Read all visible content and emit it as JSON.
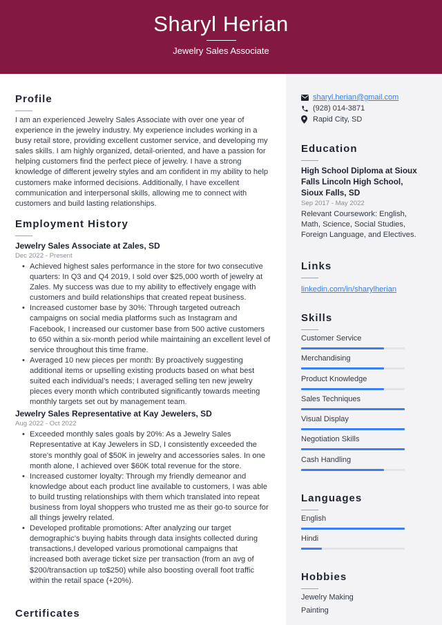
{
  "header": {
    "name": "Sharyl Herian",
    "job_title": "Jewelry Sales Associate",
    "background_color": "#831941"
  },
  "profile": {
    "title": "Profile",
    "text": "I am an experienced Jewelry Sales Associate with over one year of experience in the jewelry industry. My experience includes working in a busy retail store, providing excellent customer service, and developing my sales skills. I am highly organized, detail-oriented, and have a passion for helping customers find the perfect piece of jewelry. I have a strong knowledge of different jewelry styles and am confident in my ability to help customers make informed decisions. Additionally, I have excellent communication and interpersonal skills, allowing me to connect with customers and build lasting relationships."
  },
  "employment": {
    "title": "Employment History",
    "jobs": [
      {
        "title": "Jewelry Sales Associate at Zales, SD",
        "dates": "Dec 2022 - Present",
        "bullets": [
          "Achieved highest sales performance in the store for two consecutive quarters: In Q3 and Q4 2019, I sold over $25,000 worth of jewelry at Zales. My success was due to my ability to effectively engage with customers and build relationships that created repeat business.",
          "Increased customer base by 30%: Through targeted outreach campaigns on social media platforms such as Instagram and Facebook, I increased our customer base from 500 active customers to 650 within a six-month period while maintaining an excellent level of service throughout this time frame.",
          "Averaged 10 new pieces per month: By proactively suggesting additional items or upselling existing products based on what best suited each individual’s needs; I averaged selling ten new jewelry pieces every month which contributed significantly towards meeting monthly targets set out by management team."
        ]
      },
      {
        "title": "Jewelry Sales Representative at Kay Jewelers, SD",
        "dates": "Aug 2022 - Oct 2022",
        "bullets": [
          "Exceeded monthly sales goals by 20%: As a Jewelry Sales Representative at Kay Jewelers in SD, I consistently exceeded the store's monthly goal of $50K in jewelry and accessories sales. In one month alone, I achieved over $60K total revenue for the store.",
          "Increased customer loyalty: Through my friendly demeanor and knowledge about each product line available to customers, I was able to build trusting relationships with them which translated into repeat business from loyal shoppers who trusted me as their go-to source for all things jewelry related.",
          "Developed profitable promotions: After analyzing our target demographic’s buying habits through data insights collected during transactions,I developed various promotional campaigns that increased both average ticket size per transaction (from an avg of $200/transaction up to$250) while also boosting overall foot traffic within the retail space (+20%)."
        ]
      }
    ]
  },
  "certificates": {
    "title": "Certificates"
  },
  "contact": {
    "email": "sharyl.herian@gmail.com",
    "phone": "(928) 014-3871",
    "location": "Rapid City, SD",
    "icons": [
      "envelope-icon",
      "phone-icon",
      "map-pin-icon"
    ]
  },
  "education": {
    "title": "Education",
    "degree": "High School Diploma at Sioux Falls Lincoln High School, Sioux Falls, SD",
    "dates": "Sep 2017 - May 2022",
    "description": "Relevant Coursework: English, Math, Science, Social Studies, Foreign Language, and Electives."
  },
  "links": {
    "title": "Links",
    "items": [
      "linkedin.com/in/sharylherian"
    ]
  },
  "skills": {
    "title": "Skills",
    "accent_color": "#3a7ff0",
    "items": [
      {
        "label": "Customer Service",
        "level": 80
      },
      {
        "label": "Merchandising",
        "level": 80
      },
      {
        "label": "Product Knowledge",
        "level": 80
      },
      {
        "label": "Sales Techniques",
        "level": 100
      },
      {
        "label": "Visual Display",
        "level": 100
      },
      {
        "label": "Negotiation Skills",
        "level": 100
      },
      {
        "label": "Cash Handling",
        "level": 80
      }
    ]
  },
  "languages": {
    "title": "Languages",
    "items": [
      {
        "label": "English",
        "level": 100
      },
      {
        "label": "Hindi",
        "level": 20
      }
    ]
  },
  "hobbies": {
    "title": "Hobbies",
    "items": [
      "Jewelry Making",
      "Painting"
    ]
  }
}
